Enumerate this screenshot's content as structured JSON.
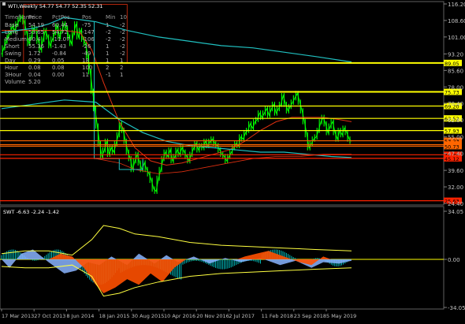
{
  "header": {
    "symbol_title": "WTI,Weekly",
    "ohlc": "54.77 54.77 52.35 52.31"
  },
  "table": {
    "headers": [
      "Timeframe",
      "Price",
      "PctPos",
      "Pos",
      "Min",
      "10"
    ],
    "rows": [
      [
        "Base",
        "54.19",
        "60.44",
        "-75",
        "1",
        "-2"
      ],
      [
        "Long",
        "53.65",
        "54.72",
        "-147",
        "-2",
        "-2"
      ],
      [
        "Medium",
        "60.4",
        "-11.07",
        "-106",
        "-2",
        "-2"
      ],
      [
        "Short",
        "55.36",
        "-1.43",
        "-26",
        "1",
        "-2"
      ],
      [
        "Swing",
        "1.72",
        "-0.84",
        "-49",
        "1",
        "-2"
      ],
      [
        "Day",
        "0.29",
        "0.05",
        "18",
        "1",
        "1"
      ],
      [
        "Hour",
        "0.08",
        "0.08",
        "100",
        "2",
        "2"
      ],
      [
        "3Hour",
        "0.04",
        "0.00",
        "11",
        "-1",
        "1"
      ],
      [
        "Volume",
        "5.20",
        "",
        "",
        "",
        ""
      ]
    ]
  },
  "price_axis": {
    "ticks": [
      "116.20",
      "108.60",
      "101.00",
      "93.20",
      "85.60",
      "78.00",
      "70.40",
      "62.80",
      "55.00",
      "47.40",
      "39.60",
      "32.00",
      "24.40"
    ]
  },
  "level_labels": [
    "89.05",
    "75.73",
    "69.20",
    "63.52",
    "57.93",
    "53.23",
    "51.42",
    "50.73",
    "46.79",
    "45.12",
    "25.63"
  ],
  "level_colors": {
    "yellow": "#ffff00",
    "orange": "#ff6600",
    "red": "#ff2200"
  },
  "indicator": {
    "label": "SWT -6.63 -2.24 -1.42",
    "ticks": [
      "34.05",
      "0.00",
      "-34.05"
    ]
  },
  "time_axis": {
    "labels": [
      "17 Mar 2013",
      "27 Oct 2013",
      "8 Jun 2014",
      "18 Jan 2015",
      "30 Aug 2015",
      "10 Apr 2016",
      "20 Nov 2016",
      "2 Jul 2017",
      "11 Feb 2018",
      "23 Sep 2018",
      "5 May 2019"
    ]
  },
  "colors": {
    "background": "#000000",
    "candles": "#00ff00",
    "teal_line": "#20c0c0",
    "ma_line": "#e03010",
    "swt_orange": "#ff5000",
    "swt_blue": "#8ab4ff",
    "swt_hist": "#00bfbf"
  }
}
